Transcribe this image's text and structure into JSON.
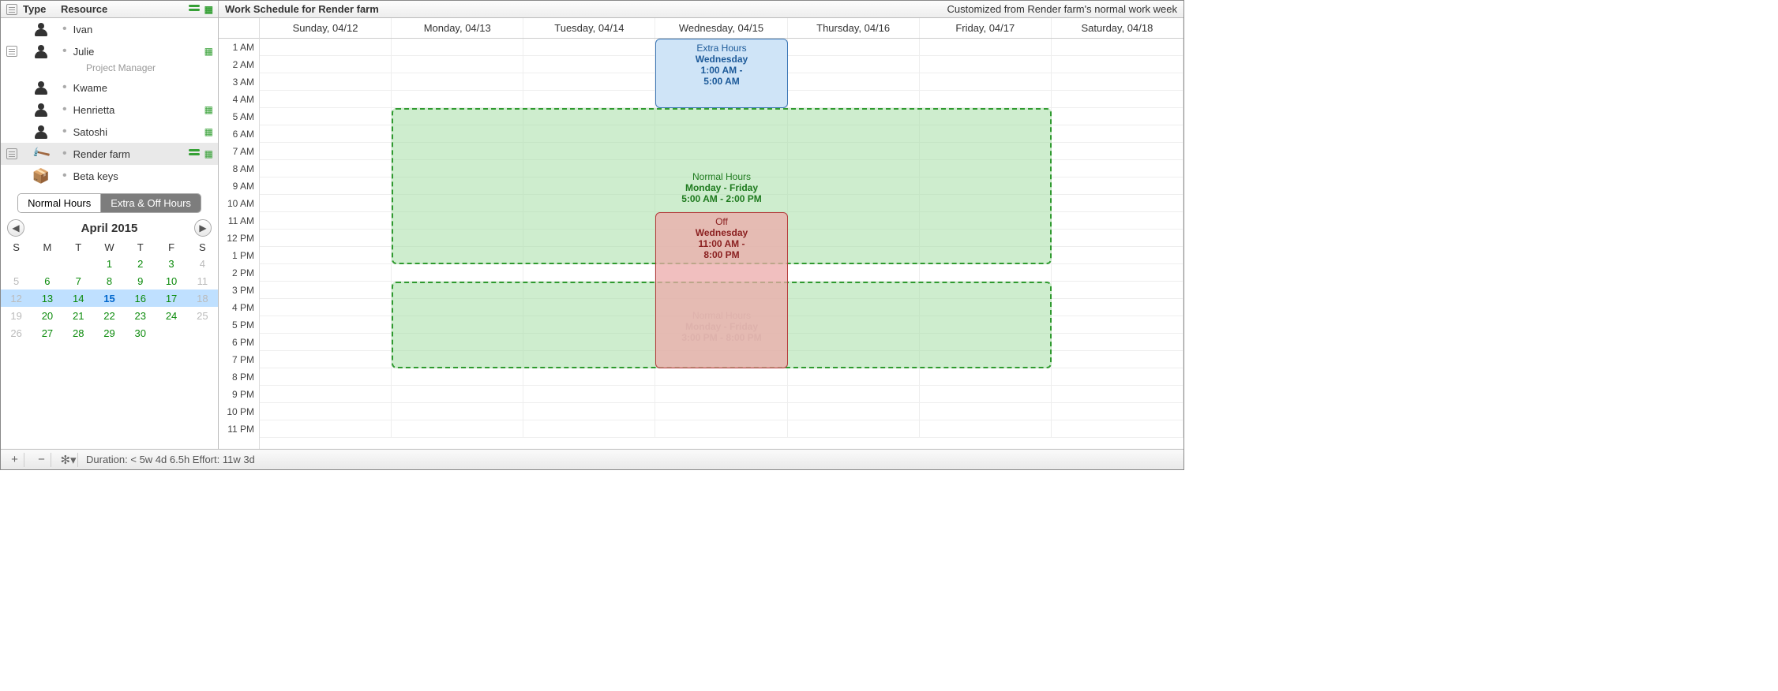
{
  "sidebar": {
    "columns": {
      "type": "Type",
      "resource": "Resource"
    },
    "rows": [
      {
        "name": "Ivan",
        "kind": "person",
        "note": false,
        "sched": false,
        "bars": false,
        "role": ""
      },
      {
        "name": "Julie",
        "kind": "person",
        "note": true,
        "sched": true,
        "bars": false,
        "role": "Project Manager"
      },
      {
        "name": "Kwame",
        "kind": "person",
        "note": false,
        "sched": false,
        "bars": false,
        "role": ""
      },
      {
        "name": "Henrietta",
        "kind": "person",
        "note": false,
        "sched": true,
        "bars": false,
        "role": ""
      },
      {
        "name": "Satoshi",
        "kind": "person",
        "note": false,
        "sched": true,
        "bars": false,
        "role": ""
      },
      {
        "name": "Render farm",
        "kind": "tool",
        "note": true,
        "sched": true,
        "bars": true,
        "role": "",
        "selected": true
      },
      {
        "name": "Beta keys",
        "kind": "material",
        "note": false,
        "sched": false,
        "bars": false,
        "role": ""
      }
    ],
    "seg": {
      "normal": "Normal Hours",
      "extra": "Extra & Off Hours"
    },
    "calendar": {
      "title": "April 2015",
      "dow": [
        "S",
        "M",
        "T",
        "W",
        "T",
        "F",
        "S"
      ],
      "weeks": [
        [
          {
            "d": "",
            "c": "dim"
          },
          {
            "d": "",
            "c": "dim"
          },
          {
            "d": "",
            "c": "dim"
          },
          {
            "d": "1",
            "c": "work"
          },
          {
            "d": "2",
            "c": "work"
          },
          {
            "d": "3",
            "c": "work"
          },
          {
            "d": "4",
            "c": "dim"
          }
        ],
        [
          {
            "d": "5",
            "c": "dim"
          },
          {
            "d": "6",
            "c": "work"
          },
          {
            "d": "7",
            "c": "work"
          },
          {
            "d": "8",
            "c": "work"
          },
          {
            "d": "9",
            "c": "work"
          },
          {
            "d": "10",
            "c": "work"
          },
          {
            "d": "11",
            "c": "dim"
          }
        ],
        [
          {
            "d": "12",
            "c": "dim"
          },
          {
            "d": "13",
            "c": "work"
          },
          {
            "d": "14",
            "c": "work"
          },
          {
            "d": "15",
            "c": "work today"
          },
          {
            "d": "16",
            "c": "work"
          },
          {
            "d": "17",
            "c": "work"
          },
          {
            "d": "18",
            "c": "dim"
          }
        ],
        [
          {
            "d": "19",
            "c": "dim"
          },
          {
            "d": "20",
            "c": "work"
          },
          {
            "d": "21",
            "c": "work"
          },
          {
            "d": "22",
            "c": "work"
          },
          {
            "d": "23",
            "c": "work"
          },
          {
            "d": "24",
            "c": "work"
          },
          {
            "d": "25",
            "c": "dim"
          }
        ],
        [
          {
            "d": "26",
            "c": "dim"
          },
          {
            "d": "27",
            "c": "work"
          },
          {
            "d": "28",
            "c": "work"
          },
          {
            "d": "29",
            "c": "work"
          },
          {
            "d": "30",
            "c": "work"
          },
          {
            "d": "",
            "c": "dim"
          },
          {
            "d": "",
            "c": "dim"
          }
        ],
        [
          {
            "d": "",
            "c": "dim"
          },
          {
            "d": "",
            "c": "dim"
          },
          {
            "d": "",
            "c": "dim"
          },
          {
            "d": "",
            "c": "dim"
          },
          {
            "d": "",
            "c": "dim"
          },
          {
            "d": "",
            "c": "dim"
          },
          {
            "d": "",
            "c": "dim"
          }
        ]
      ],
      "selected_week_index": 2
    }
  },
  "schedule": {
    "title": "Work Schedule for Render farm",
    "subtitle": "Customized from Render farm's normal work week",
    "days": [
      "Sunday, 04/12",
      "Monday, 04/13",
      "Tuesday, 04/14",
      "Wednesday, 04/15",
      "Thursday, 04/16",
      "Friday, 04/17",
      "Saturday, 04/18"
    ],
    "hours": [
      "1 AM",
      "2 AM",
      "3 AM",
      "4 AM",
      "5 AM",
      "6 AM",
      "7 AM",
      "8 AM",
      "9 AM",
      "10 AM",
      "11 AM",
      "12 PM",
      "1 PM",
      "2 PM",
      "3 PM",
      "4 PM",
      "5 PM",
      "6 PM",
      "7 PM",
      "8 PM",
      "9 PM",
      "10 PM",
      "11 PM"
    ],
    "blocks": {
      "extra": {
        "title": "Extra Hours",
        "line1": "Wednesday",
        "line2": "1:00 AM -",
        "line3": "5:00 AM"
      },
      "normal1": {
        "title": "Normal Hours",
        "line1": "Monday - Friday",
        "line2": "5:00 AM - 2:00 PM"
      },
      "off": {
        "title": "Off",
        "line1": "Wednesday",
        "line2": "11:00 AM -",
        "line3": "8:00 PM"
      },
      "normal2": {
        "title": "Normal Hours",
        "line1": "Monday - Friday",
        "line2": "3:00 PM - 8:00 PM"
      }
    }
  },
  "footer": {
    "summary": "Duration: < 5w 4d 6.5h  Effort: 11w 3d"
  }
}
